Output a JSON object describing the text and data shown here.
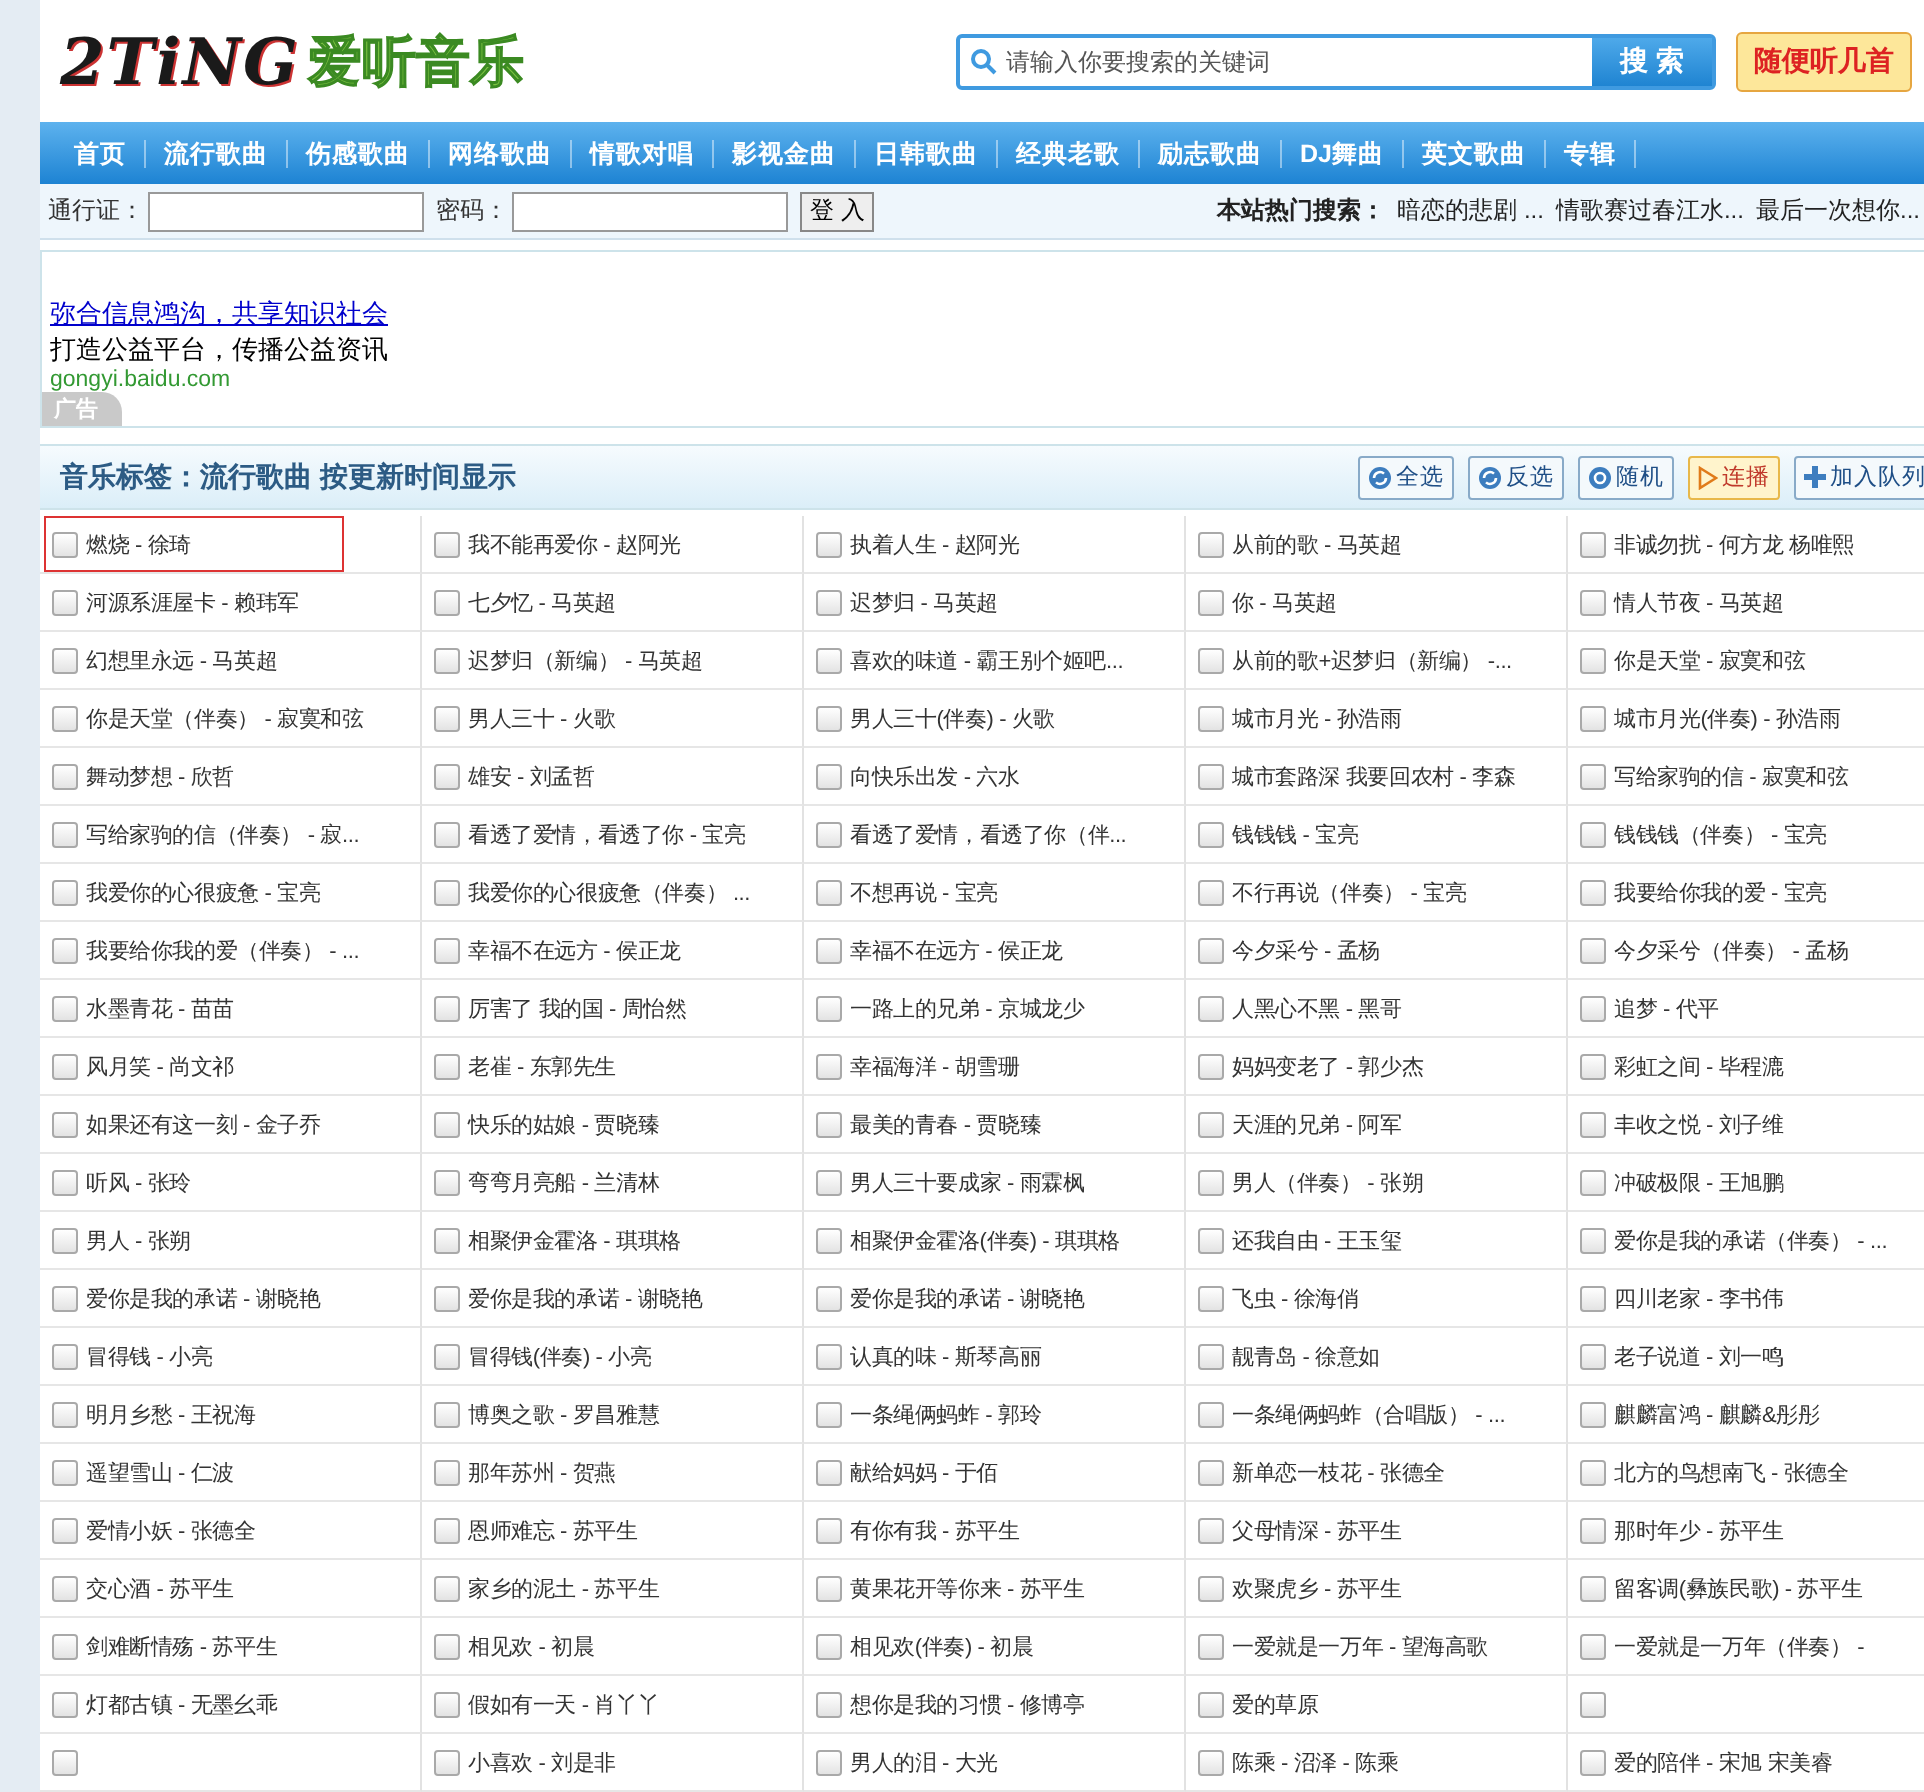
{
  "logo": {
    "mark": "2TiNG",
    "name": "爱听音乐"
  },
  "search": {
    "placeholder": "请输入你要搜索的关键词",
    "button": "搜 索"
  },
  "random_button": "随便听几首",
  "nav": [
    "首页",
    "流行歌曲",
    "伤感歌曲",
    "网络歌曲",
    "情歌对唱",
    "影视金曲",
    "日韩歌曲",
    "经典老歌",
    "励志歌曲",
    "DJ舞曲",
    "英文歌曲",
    "专辑"
  ],
  "login": {
    "user_label": "通行证：",
    "password_label": "密码：",
    "button": "登 入"
  },
  "hot_search": {
    "label": "本站热门搜索：",
    "items": [
      "暗恋的悲剧 ...",
      "情歌赛过春江水...",
      "最后一次想你..."
    ]
  },
  "ad": {
    "link": "弥合信息鸿沟，共享知识社会",
    "text": "打造公益平台，传播公益资讯",
    "url": "gongyi.baidu.com",
    "tag": "广告"
  },
  "tag_bar": {
    "title": "音乐标签：流行歌曲 按更新时间显示",
    "buttons": [
      {
        "label": "全选",
        "kind": "refresh",
        "active": false
      },
      {
        "label": "反选",
        "kind": "refresh",
        "active": false
      },
      {
        "label": "随机",
        "kind": "shuffle",
        "active": false
      },
      {
        "label": "连播",
        "kind": "play",
        "active": true
      },
      {
        "label": "加入队列",
        "kind": "add",
        "active": false
      }
    ]
  },
  "songs": [
    {
      "label": "燃烧 - 徐琦",
      "checked": false,
      "highlighted": true
    },
    {
      "label": "我不能再爱你 - 赵阿光",
      "checked": false,
      "highlighted": false
    },
    {
      "label": "执着人生 - 赵阿光",
      "checked": false,
      "highlighted": false
    },
    {
      "label": "从前的歌 - 马英超",
      "checked": false,
      "highlighted": false
    },
    {
      "label": "非诚勿扰 - 何方龙 杨唯熙",
      "checked": false,
      "highlighted": false
    },
    {
      "label": "河源系涯屋卡 - 赖玮军",
      "checked": false,
      "highlighted": false
    },
    {
      "label": "七夕忆 - 马英超",
      "checked": false,
      "highlighted": false
    },
    {
      "label": "迟梦归 - 马英超",
      "checked": false,
      "highlighted": false
    },
    {
      "label": "你 - 马英超",
      "checked": false,
      "highlighted": false
    },
    {
      "label": "情人节夜 - 马英超",
      "checked": false,
      "highlighted": false
    },
    {
      "label": "幻想里永远 - 马英超",
      "checked": false,
      "highlighted": false
    },
    {
      "label": "迟梦归（新编） - 马英超",
      "checked": false,
      "highlighted": false
    },
    {
      "label": "喜欢的味道 - 霸王别个姬吧...",
      "checked": false,
      "highlighted": false
    },
    {
      "label": "从前的歌+迟梦归（新编） -...",
      "checked": false,
      "highlighted": false
    },
    {
      "label": "你是天堂 - 寂寞和弦",
      "checked": false,
      "highlighted": false
    },
    {
      "label": "你是天堂（伴奏） - 寂寞和弦",
      "checked": false,
      "highlighted": false
    },
    {
      "label": "男人三十 - 火歌",
      "checked": false,
      "highlighted": false
    },
    {
      "label": "男人三十(伴奏) - 火歌",
      "checked": false,
      "highlighted": false
    },
    {
      "label": "城市月光 - 孙浩雨",
      "checked": false,
      "highlighted": false
    },
    {
      "label": "城市月光(伴奏) - 孙浩雨",
      "checked": false,
      "highlighted": false
    },
    {
      "label": "舞动梦想 - 欣哲",
      "checked": false,
      "highlighted": false
    },
    {
      "label": "雄安 - 刘孟哲",
      "checked": false,
      "highlighted": false
    },
    {
      "label": "向快乐出发 - 六水",
      "checked": false,
      "highlighted": false
    },
    {
      "label": "城市套路深 我要回农村 - 李森",
      "checked": false,
      "highlighted": false
    },
    {
      "label": "写给家驹的信 - 寂寞和弦",
      "checked": false,
      "highlighted": false
    },
    {
      "label": "写给家驹的信（伴奏） - 寂...",
      "checked": false,
      "highlighted": false
    },
    {
      "label": "看透了爱情，看透了你 - 宝亮",
      "checked": false,
      "highlighted": false
    },
    {
      "label": "看透了爱情，看透了你（伴...",
      "checked": false,
      "highlighted": false
    },
    {
      "label": "钱钱钱 - 宝亮",
      "checked": false,
      "highlighted": false
    },
    {
      "label": "钱钱钱（伴奏） - 宝亮",
      "checked": false,
      "highlighted": false
    },
    {
      "label": "我爱你的心很疲惫 - 宝亮",
      "checked": false,
      "highlighted": false
    },
    {
      "label": "我爱你的心很疲惫（伴奏） ...",
      "checked": false,
      "highlighted": false
    },
    {
      "label": "不想再说 - 宝亮",
      "checked": false,
      "highlighted": false
    },
    {
      "label": "不行再说（伴奏） - 宝亮",
      "checked": false,
      "highlighted": false
    },
    {
      "label": "我要给你我的爱 - 宝亮",
      "checked": false,
      "highlighted": false
    },
    {
      "label": "我要给你我的爱（伴奏） - ...",
      "checked": false,
      "highlighted": false
    },
    {
      "label": "幸福不在远方 - 侯正龙",
      "checked": false,
      "highlighted": false
    },
    {
      "label": "幸福不在远方 - 侯正龙",
      "checked": false,
      "highlighted": false
    },
    {
      "label": "今夕采兮 - 孟杨",
      "checked": false,
      "highlighted": false
    },
    {
      "label": "今夕采兮（伴奏） - 孟杨",
      "checked": false,
      "highlighted": false
    },
    {
      "label": "水墨青花 - 苗苗",
      "checked": false,
      "highlighted": false
    },
    {
      "label": "厉害了 我的国 - 周怡然",
      "checked": false,
      "highlighted": false
    },
    {
      "label": "一路上的兄弟 - 京城龙少",
      "checked": false,
      "highlighted": false
    },
    {
      "label": "人黑心不黑 - 黑哥",
      "checked": false,
      "highlighted": false
    },
    {
      "label": "追梦 - 代平",
      "checked": false,
      "highlighted": false
    },
    {
      "label": "风月笑 - 尚文祁",
      "checked": false,
      "highlighted": false
    },
    {
      "label": "老崔 - 东郭先生",
      "checked": false,
      "highlighted": false
    },
    {
      "label": "幸福海洋 - 胡雪珊",
      "checked": false,
      "highlighted": false
    },
    {
      "label": "妈妈变老了 - 郭少杰",
      "checked": false,
      "highlighted": false
    },
    {
      "label": "彩虹之间 - 毕程漉",
      "checked": false,
      "highlighted": false
    },
    {
      "label": "如果还有这一刻 - 金子乔",
      "checked": false,
      "highlighted": false
    },
    {
      "label": "快乐的姑娘 - 贾晓臻",
      "checked": false,
      "highlighted": false
    },
    {
      "label": "最美的青春 - 贾晓臻",
      "checked": false,
      "highlighted": false
    },
    {
      "label": "天涯的兄弟 - 阿军",
      "checked": false,
      "highlighted": false
    },
    {
      "label": "丰收之悦 - 刘子维",
      "checked": false,
      "highlighted": false
    },
    {
      "label": "听风 - 张玲",
      "checked": false,
      "highlighted": false
    },
    {
      "label": "弯弯月亮船 - 兰清林",
      "checked": false,
      "highlighted": false
    },
    {
      "label": "男人三十要成家 - 雨霖枫",
      "checked": false,
      "highlighted": false
    },
    {
      "label": "男人（伴奏） - 张朔",
      "checked": false,
      "highlighted": false
    },
    {
      "label": "冲破极限 - 王旭鹏",
      "checked": false,
      "highlighted": false
    },
    {
      "label": "男人 - 张朔",
      "checked": false,
      "highlighted": false
    },
    {
      "label": "相聚伊金霍洛 - 琪琪格",
      "checked": false,
      "highlighted": false
    },
    {
      "label": "相聚伊金霍洛(伴奏) - 琪琪格",
      "checked": false,
      "highlighted": false
    },
    {
      "label": "还我自由 - 王玉玺",
      "checked": false,
      "highlighted": false
    },
    {
      "label": "爱你是我的承诺（伴奏） - ...",
      "checked": false,
      "highlighted": false
    },
    {
      "label": "爱你是我的承诺 - 谢晓艳",
      "checked": false,
      "highlighted": false
    },
    {
      "label": "爱你是我的承诺 - 谢晓艳",
      "checked": false,
      "highlighted": false
    },
    {
      "label": "爱你是我的承诺 - 谢晓艳",
      "checked": false,
      "highlighted": false
    },
    {
      "label": "飞虫 - 徐海俏",
      "checked": false,
      "highlighted": false
    },
    {
      "label": "四川老家 - 李书伟",
      "checked": false,
      "highlighted": false
    },
    {
      "label": "冒得钱 - 小亮",
      "checked": false,
      "highlighted": false
    },
    {
      "label": "冒得钱(伴奏) - 小亮",
      "checked": false,
      "highlighted": false
    },
    {
      "label": "认真的味 - 斯琴高丽",
      "checked": false,
      "highlighted": false
    },
    {
      "label": "靓青岛 - 徐意如",
      "checked": false,
      "highlighted": false
    },
    {
      "label": "老子说道 - 刘一鸣",
      "checked": false,
      "highlighted": false
    },
    {
      "label": "明月乡愁 - 王祝海",
      "checked": false,
      "highlighted": false
    },
    {
      "label": "博奥之歌 - 罗昌雅慧",
      "checked": false,
      "highlighted": false
    },
    {
      "label": "一条绳俩蚂蚱 - 郭玲",
      "checked": false,
      "highlighted": false
    },
    {
      "label": "一条绳俩蚂蚱（合唱版） - ...",
      "checked": false,
      "highlighted": false
    },
    {
      "label": "麒麟富鸿 - 麒麟&彤彤",
      "checked": false,
      "highlighted": false
    },
    {
      "label": "遥望雪山 - 仁波",
      "checked": false,
      "highlighted": false
    },
    {
      "label": "那年苏州 - 贺燕",
      "checked": false,
      "highlighted": false
    },
    {
      "label": "献给妈妈 - 于佰",
      "checked": false,
      "highlighted": false
    },
    {
      "label": "新单恋一枝花 - 张德全",
      "checked": false,
      "highlighted": false
    },
    {
      "label": "北方的鸟想南飞 - 张德全",
      "checked": false,
      "highlighted": false
    },
    {
      "label": "爱情小妖 - 张德全",
      "checked": false,
      "highlighted": false
    },
    {
      "label": "恩师难忘 - 苏平生",
      "checked": false,
      "highlighted": false
    },
    {
      "label": "有你有我 - 苏平生",
      "checked": false,
      "highlighted": false
    },
    {
      "label": "父母情深 - 苏平生",
      "checked": false,
      "highlighted": false
    },
    {
      "label": "那时年少 - 苏平生",
      "checked": false,
      "highlighted": false
    },
    {
      "label": "交心酒 - 苏平生",
      "checked": false,
      "highlighted": false
    },
    {
      "label": "家乡的泥土 - 苏平生",
      "checked": false,
      "highlighted": false
    },
    {
      "label": "黄果花开等你来 - 苏平生",
      "checked": false,
      "highlighted": false
    },
    {
      "label": "欢聚虎乡 - 苏平生",
      "checked": false,
      "highlighted": false
    },
    {
      "label": "留客调(彝族民歌) - 苏平生",
      "checked": false,
      "highlighted": false
    },
    {
      "label": "剑难断情殇 - 苏平生",
      "checked": false,
      "highlighted": false
    },
    {
      "label": "相见欢 - 初晨",
      "checked": false,
      "highlighted": false
    },
    {
      "label": "相见欢(伴奏) - 初晨",
      "checked": false,
      "highlighted": false
    },
    {
      "label": "一爱就是一万年 - 望海高歌",
      "checked": false,
      "highlighted": false
    },
    {
      "label": "一爱就是一万年（伴奏） -",
      "checked": false,
      "highlighted": false
    },
    {
      "label": "灯都古镇 - 无墨幺乖",
      "checked": false,
      "highlighted": false
    },
    {
      "label": "假如有一天 - 肖丫丫",
      "checked": false,
      "highlighted": false
    },
    {
      "label": "想你是我的习惯 - 修博亭",
      "checked": false,
      "highlighted": false
    },
    {
      "label": "爱的草原",
      "checked": false,
      "highlighted": false
    },
    {
      "checked": false,
      "highlighted": false
    },
    {
      "checked": false,
      "highlighted": false
    },
    {
      "label": "小喜欢 - 刘是非",
      "checked": false,
      "highlighted": false
    },
    {
      "label": "男人的泪 - 大光",
      "checked": false,
      "highlighted": false
    },
    {
      "label": "陈乘 - 沼泽 - 陈乘",
      "checked": false,
      "highlighted": false
    },
    {
      "label": "爱的陪伴 - 宋旭 宋美睿",
      "checked": false,
      "highlighted": false
    }
  ]
}
